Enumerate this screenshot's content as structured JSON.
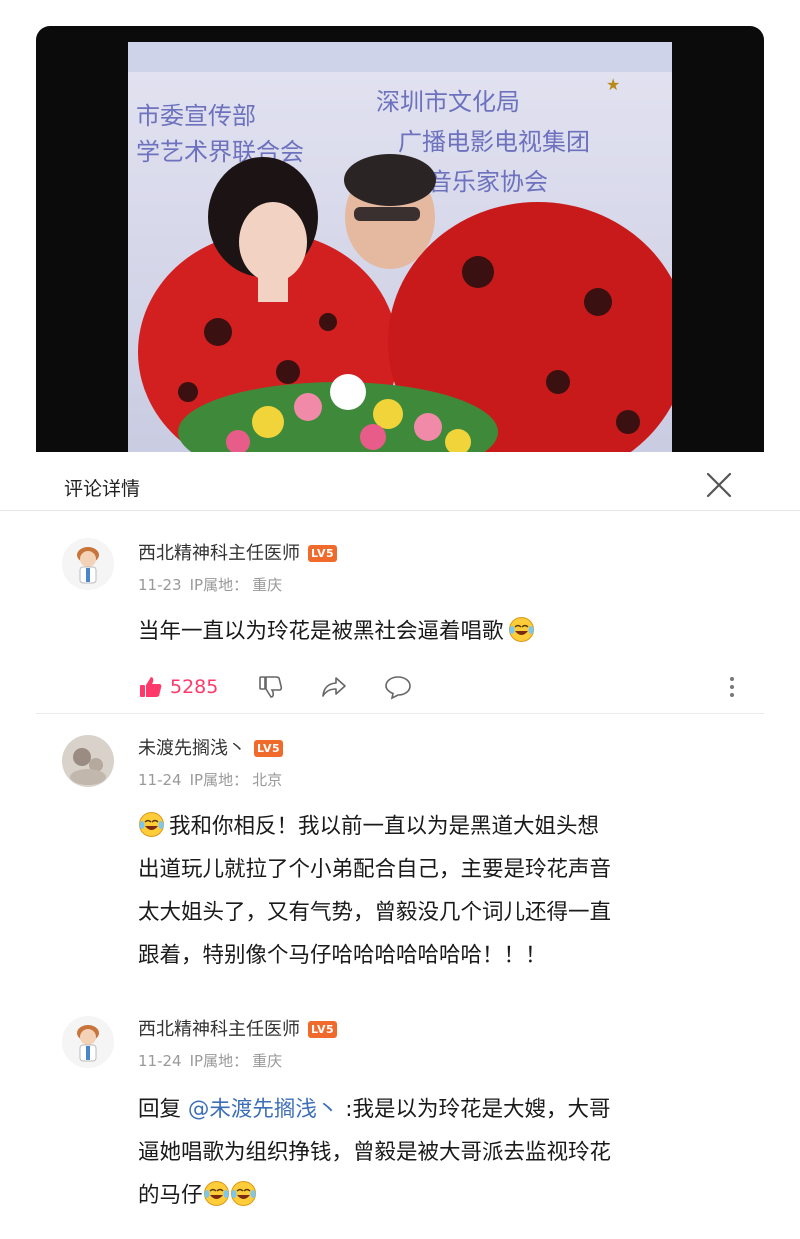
{
  "panel": {
    "title": "评论详情"
  },
  "comments": [
    {
      "username": "西北精神科主任医师",
      "level": "LV5",
      "date": "11-23",
      "ip_label": "IP属地：",
      "ip_location": "重庆",
      "text": "当年一直以为玲花是被黑社会逼着唱歌",
      "likes": "5285"
    },
    {
      "username": "未渡先搁浅丶",
      "level": "LV5",
      "date": "11-24",
      "ip_label": "IP属地：",
      "ip_location": "北京",
      "text_lines": [
        "我和你相反！我以前一直以为是黑道大姐头想",
        "出道玩儿就拉了个小弟配合自己，主要是玲花声音",
        "太大姐头了，又有气势，曾毅没几个词儿还得一直",
        "跟着，特别像个马仔哈哈哈哈哈哈哈！！！"
      ]
    },
    {
      "username": "西北精神科主任医师",
      "level": "LV5",
      "date": "11-24",
      "ip_label": "IP属地：",
      "ip_location": "重庆",
      "reply_prefix": "回复",
      "mention": "@未渡先搁浅丶",
      "text_lines": [
        ":我是以为玲花是大嫂，大哥",
        "逼她唱歌为组织挣钱，曾毅是被大哥派去监视玲花",
        "的马仔"
      ]
    }
  ],
  "video": {
    "banner_line1": "深圳市文化局",
    "banner_line2": "市委宣传部",
    "banner_line3": "学艺术界联合会",
    "banner_line4": "广播电影电视集团",
    "banner_line5": "音乐家协会"
  },
  "colors": {
    "like": "#ff3a6a",
    "mention": "#3d6fb8",
    "level_badge": "#f06a2c"
  }
}
